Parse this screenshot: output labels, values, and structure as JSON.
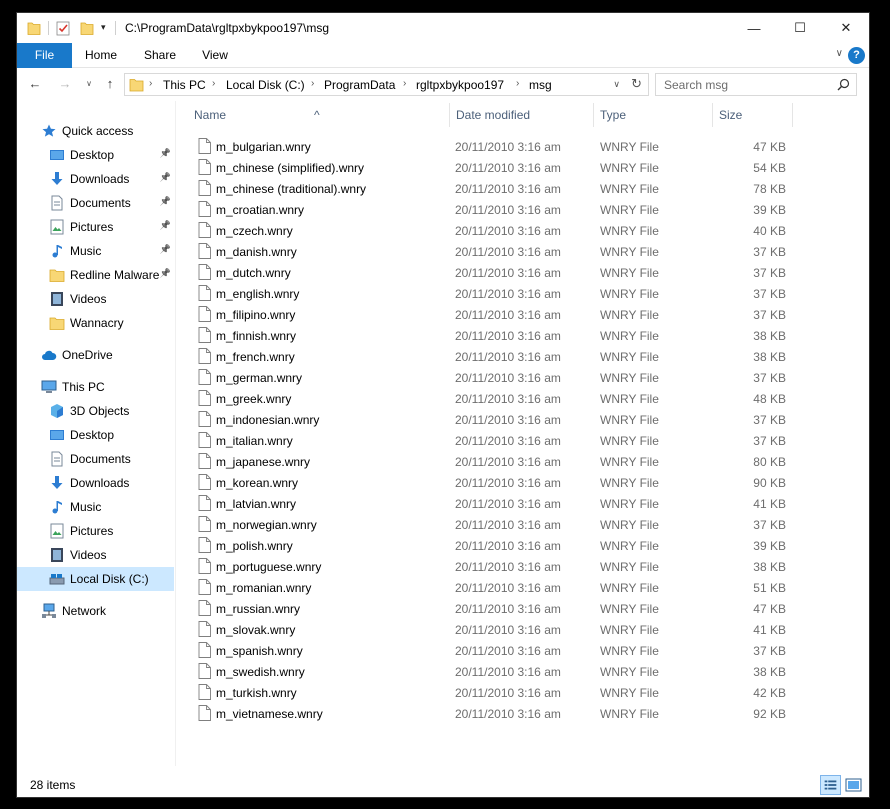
{
  "window": {
    "title": "C:\\ProgramData\\rgltpxbykpoo197\\msg",
    "minimize_glyph": "—",
    "maximize_glyph": "☐",
    "close_glyph": "✕"
  },
  "quick_access_toolbar": {
    "icons": [
      "folder-icon",
      "properties-check-icon",
      "new-folder-icon",
      "customize-arrow-icon"
    ],
    "customize_glyph": "▾"
  },
  "ribbon": {
    "tabs": [
      "File",
      "Home",
      "Share",
      "View"
    ],
    "expand_glyph": "∨",
    "help_glyph": "?"
  },
  "navigation": {
    "back_glyph": "←",
    "forward_glyph": "→",
    "recent_glyph": "∨",
    "up_glyph": "↑",
    "breadcrumb": [
      "This PC",
      "Local Disk (C:)",
      "ProgramData",
      "rgltpxbykpoo197",
      "msg"
    ],
    "chevron_glyph": "›",
    "dropdown_glyph": "∨",
    "refresh_glyph": "↻",
    "search_placeholder": "Search msg"
  },
  "nav_pane": {
    "items": [
      {
        "label": "Quick access",
        "icon": "star-icon",
        "level": 0,
        "pinned": false,
        "selected": false
      },
      {
        "label": "Desktop",
        "icon": "desktop-icon",
        "level": 1,
        "pinned": true,
        "selected": false
      },
      {
        "label": "Downloads",
        "icon": "downloads-icon",
        "level": 1,
        "pinned": true,
        "selected": false
      },
      {
        "label": "Documents",
        "icon": "documents-icon",
        "level": 1,
        "pinned": true,
        "selected": false
      },
      {
        "label": "Pictures",
        "icon": "pictures-icon",
        "level": 1,
        "pinned": true,
        "selected": false
      },
      {
        "label": "Music",
        "icon": "music-icon",
        "level": 1,
        "pinned": true,
        "selected": false
      },
      {
        "label": "Redline Malware",
        "icon": "folder-icon",
        "level": 1,
        "pinned": true,
        "selected": false
      },
      {
        "label": "Videos",
        "icon": "videos-icon",
        "level": 1,
        "pinned": false,
        "selected": false
      },
      {
        "label": "Wannacry",
        "icon": "folder-icon",
        "level": 1,
        "pinned": false,
        "selected": false
      },
      {
        "label": "OneDrive",
        "icon": "cloud-icon",
        "level": 0,
        "pinned": false,
        "selected": false
      },
      {
        "label": "This PC",
        "icon": "computer-icon",
        "level": 0,
        "pinned": false,
        "selected": false
      },
      {
        "label": "3D Objects",
        "icon": "3d-objects-icon",
        "level": 1,
        "pinned": false,
        "selected": false
      },
      {
        "label": "Desktop",
        "icon": "desktop-icon",
        "level": 1,
        "pinned": false,
        "selected": false
      },
      {
        "label": "Documents",
        "icon": "documents-icon",
        "level": 1,
        "pinned": false,
        "selected": false
      },
      {
        "label": "Downloads",
        "icon": "downloads-icon",
        "level": 1,
        "pinned": false,
        "selected": false
      },
      {
        "label": "Music",
        "icon": "music-icon",
        "level": 1,
        "pinned": false,
        "selected": false
      },
      {
        "label": "Pictures",
        "icon": "pictures-icon",
        "level": 1,
        "pinned": false,
        "selected": false
      },
      {
        "label": "Videos",
        "icon": "videos-icon",
        "level": 1,
        "pinned": false,
        "selected": false
      },
      {
        "label": "Local Disk (C:)",
        "icon": "drive-icon",
        "level": 1,
        "pinned": false,
        "selected": true
      },
      {
        "label": "Network",
        "icon": "network-icon",
        "level": 0,
        "pinned": false,
        "selected": false
      }
    ],
    "pin_glyph": "📌"
  },
  "file_list": {
    "columns": [
      "Name",
      "Date modified",
      "Type",
      "Size"
    ],
    "sort_glyph": "^",
    "rows": [
      {
        "name": "m_bulgarian.wnry",
        "date": "20/11/2010 3:16 am",
        "type": "WNRY File",
        "size": "47 KB"
      },
      {
        "name": "m_chinese (simplified).wnry",
        "date": "20/11/2010 3:16 am",
        "type": "WNRY File",
        "size": "54 KB"
      },
      {
        "name": "m_chinese (traditional).wnry",
        "date": "20/11/2010 3:16 am",
        "type": "WNRY File",
        "size": "78 KB"
      },
      {
        "name": "m_croatian.wnry",
        "date": "20/11/2010 3:16 am",
        "type": "WNRY File",
        "size": "39 KB"
      },
      {
        "name": "m_czech.wnry",
        "date": "20/11/2010 3:16 am",
        "type": "WNRY File",
        "size": "40 KB"
      },
      {
        "name": "m_danish.wnry",
        "date": "20/11/2010 3:16 am",
        "type": "WNRY File",
        "size": "37 KB"
      },
      {
        "name": "m_dutch.wnry",
        "date": "20/11/2010 3:16 am",
        "type": "WNRY File",
        "size": "37 KB"
      },
      {
        "name": "m_english.wnry",
        "date": "20/11/2010 3:16 am",
        "type": "WNRY File",
        "size": "37 KB"
      },
      {
        "name": "m_filipino.wnry",
        "date": "20/11/2010 3:16 am",
        "type": "WNRY File",
        "size": "37 KB"
      },
      {
        "name": "m_finnish.wnry",
        "date": "20/11/2010 3:16 am",
        "type": "WNRY File",
        "size": "38 KB"
      },
      {
        "name": "m_french.wnry",
        "date": "20/11/2010 3:16 am",
        "type": "WNRY File",
        "size": "38 KB"
      },
      {
        "name": "m_german.wnry",
        "date": "20/11/2010 3:16 am",
        "type": "WNRY File",
        "size": "37 KB"
      },
      {
        "name": "m_greek.wnry",
        "date": "20/11/2010 3:16 am",
        "type": "WNRY File",
        "size": "48 KB"
      },
      {
        "name": "m_indonesian.wnry",
        "date": "20/11/2010 3:16 am",
        "type": "WNRY File",
        "size": "37 KB"
      },
      {
        "name": "m_italian.wnry",
        "date": "20/11/2010 3:16 am",
        "type": "WNRY File",
        "size": "37 KB"
      },
      {
        "name": "m_japanese.wnry",
        "date": "20/11/2010 3:16 am",
        "type": "WNRY File",
        "size": "80 KB"
      },
      {
        "name": "m_korean.wnry",
        "date": "20/11/2010 3:16 am",
        "type": "WNRY File",
        "size": "90 KB"
      },
      {
        "name": "m_latvian.wnry",
        "date": "20/11/2010 3:16 am",
        "type": "WNRY File",
        "size": "41 KB"
      },
      {
        "name": "m_norwegian.wnry",
        "date": "20/11/2010 3:16 am",
        "type": "WNRY File",
        "size": "37 KB"
      },
      {
        "name": "m_polish.wnry",
        "date": "20/11/2010 3:16 am",
        "type": "WNRY File",
        "size": "39 KB"
      },
      {
        "name": "m_portuguese.wnry",
        "date": "20/11/2010 3:16 am",
        "type": "WNRY File",
        "size": "38 KB"
      },
      {
        "name": "m_romanian.wnry",
        "date": "20/11/2010 3:16 am",
        "type": "WNRY File",
        "size": "51 KB"
      },
      {
        "name": "m_russian.wnry",
        "date": "20/11/2010 3:16 am",
        "type": "WNRY File",
        "size": "47 KB"
      },
      {
        "name": "m_slovak.wnry",
        "date": "20/11/2010 3:16 am",
        "type": "WNRY File",
        "size": "41 KB"
      },
      {
        "name": "m_spanish.wnry",
        "date": "20/11/2010 3:16 am",
        "type": "WNRY File",
        "size": "37 KB"
      },
      {
        "name": "m_swedish.wnry",
        "date": "20/11/2010 3:16 am",
        "type": "WNRY File",
        "size": "38 KB"
      },
      {
        "name": "m_turkish.wnry",
        "date": "20/11/2010 3:16 am",
        "type": "WNRY File",
        "size": "42 KB"
      },
      {
        "name": "m_vietnamese.wnry",
        "date": "20/11/2010 3:16 am",
        "type": "WNRY File",
        "size": "92 KB"
      }
    ]
  },
  "status_bar": {
    "item_count": "28 items",
    "view_buttons": [
      "details-view-icon",
      "large-icons-view-icon"
    ]
  },
  "colors": {
    "accent": "#1979ca",
    "selection": "#cce8ff",
    "folder_yellow": "#f8d775",
    "header_text": "#4c607a",
    "secondary_text": "#6d6d6d"
  }
}
